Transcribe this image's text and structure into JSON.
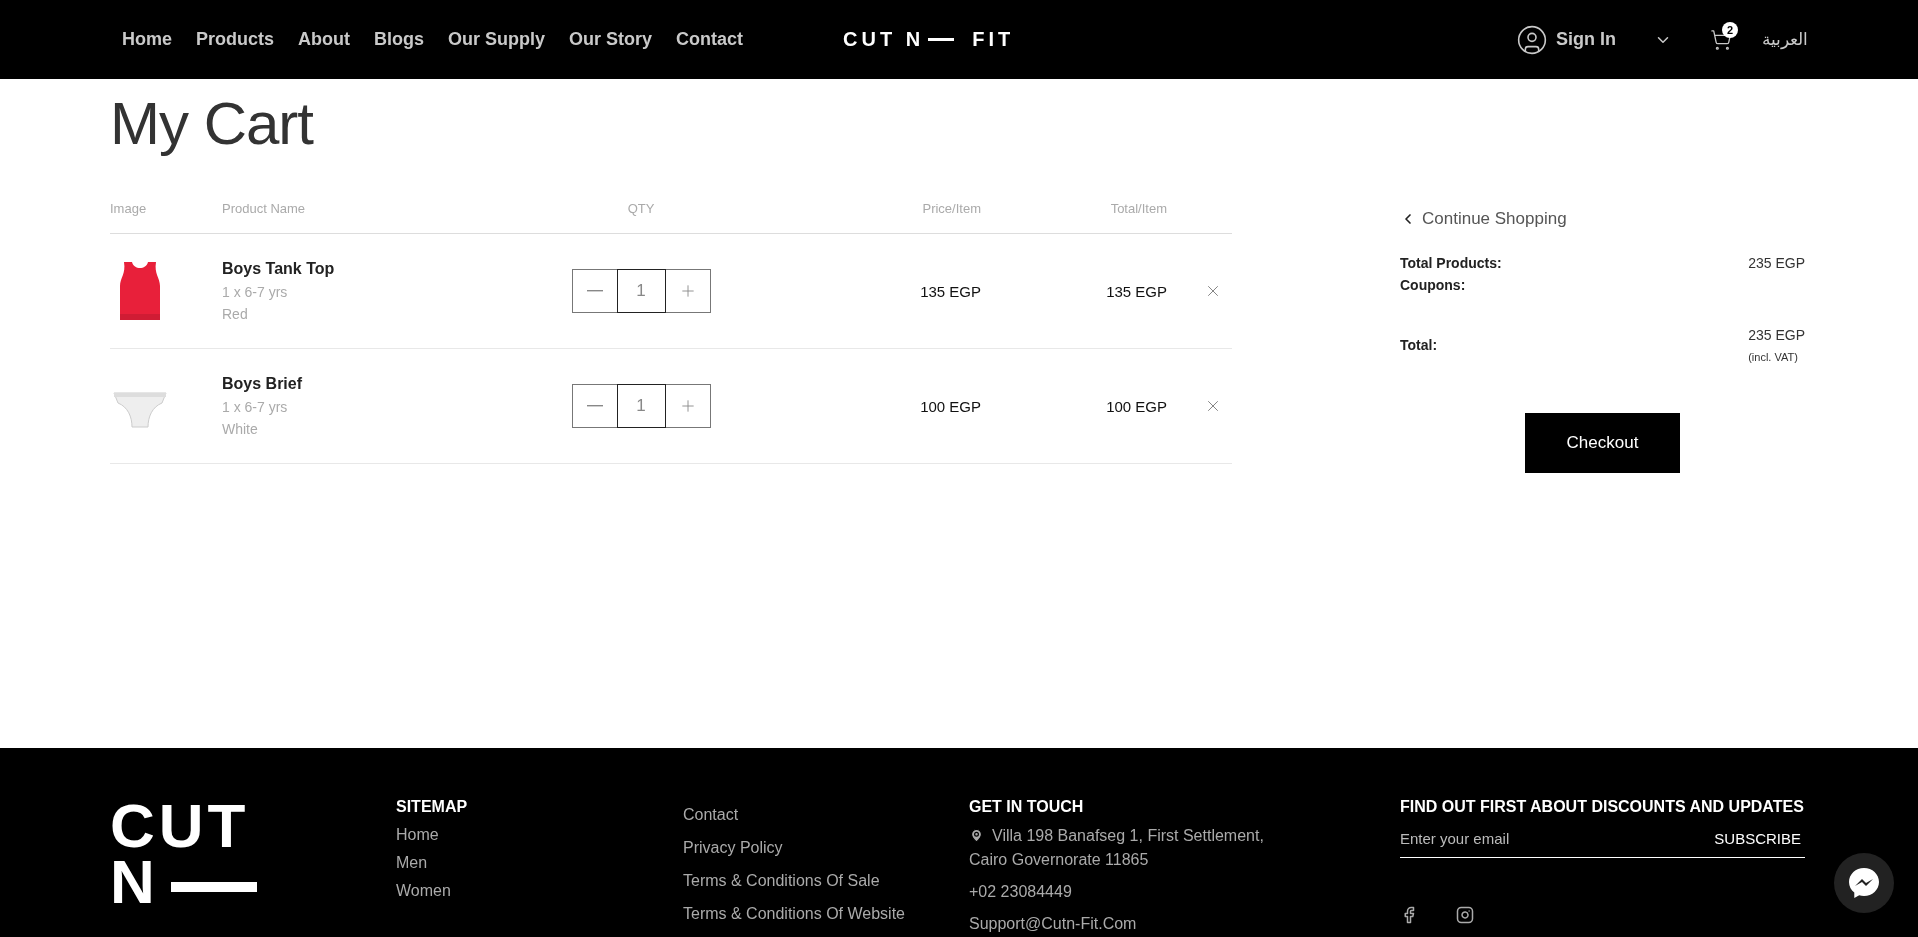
{
  "header": {
    "nav": [
      {
        "label": "Home"
      },
      {
        "label": "Products"
      },
      {
        "label": "About"
      },
      {
        "label": "Blogs"
      },
      {
        "label": "Our Supply"
      },
      {
        "label": "Our Story"
      },
      {
        "label": "Contact"
      }
    ],
    "logo": {
      "left": "CUT",
      "middle": "N",
      "right": "FIT"
    },
    "sign_in": "Sign In",
    "cart_count": "2",
    "language": "العربية"
  },
  "page_title": {
    "light": "My",
    "bold": "Cart"
  },
  "table": {
    "columns": [
      "Image",
      "Product Name",
      "QTY",
      "Price/Item",
      "Total/Item"
    ],
    "rows": [
      {
        "name": "Boys Tank Top",
        "size": "1 x 6-7 yrs",
        "variant": "Red",
        "qty": "1",
        "price": "135 EGP",
        "total": "135 EGP"
      },
      {
        "name": "Boys Brief",
        "size": "1 x 6-7 yrs",
        "variant": "White",
        "qty": "1",
        "price": "100 EGP",
        "total": "100 EGP"
      }
    ]
  },
  "summary": {
    "continue": "Continue Shopping",
    "lines": [
      {
        "label": "Total Products:",
        "value": "235 EGP"
      },
      {
        "label": "Coupons:"
      }
    ],
    "total_label": "Total:",
    "total_value": "235 EGP",
    "vat_note": "(incl. VAT)",
    "checkout": "Checkout"
  },
  "footer": {
    "logo": [
      "CUT",
      "N"
    ],
    "sitemap": {
      "title": "SITEMAP",
      "links": [
        "Home",
        "Men",
        "Women"
      ]
    },
    "links": [
      "Contact",
      "Privacy Policy",
      "Terms & Conditions Of Sale",
      "Terms & Conditions Of Website"
    ],
    "contact": {
      "title": "GET IN TOUCH",
      "address": "Villa 198 Banafseg 1, First Settlement, Cairo Governorate 11865",
      "phone": "+02 23084449",
      "email": "Support@Cutn-Fit.Com"
    },
    "newsletter": {
      "title": "FIND OUT FIRST ABOUT DISCOUNTS AND UPDATES",
      "placeholder": "Enter your email",
      "button": "SUBSCRIBE"
    }
  }
}
